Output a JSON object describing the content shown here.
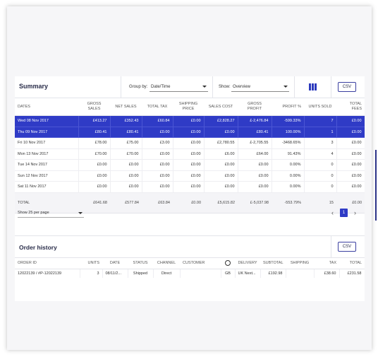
{
  "summary": {
    "title": "Summary",
    "group_by_label": "Group by:",
    "group_by_value": "Date/Time",
    "show_label": "Show:",
    "show_value": "Overview",
    "csv_label": "CSV",
    "headers": [
      "DATES",
      "GROSS SALES",
      "NET SALES",
      "TOTAL TAX",
      "SHIPPING PRICE",
      "SALES COST",
      "GROSS PROFIT",
      "PROFIT %",
      "UNITS SOLD",
      "TOTAL FEES"
    ],
    "rows": [
      {
        "selected": true,
        "cells": [
          "Wed 08 Nov 2017",
          "£413.27",
          "£352.43",
          "£60.84",
          "£0.00",
          "£2,828.27",
          "£-2,476.84",
          "-599.33%",
          "7",
          "£0.00"
        ]
      },
      {
        "selected": true,
        "cells": [
          "Thu 09 Nov 2017",
          "£80.41",
          "£80.41",
          "£0.00",
          "£0.00",
          "£0.00",
          "£80.41",
          "100.00%",
          "1",
          "£0.00"
        ]
      },
      {
        "selected": false,
        "cells": [
          "Fri 10 Nov 2017",
          "£78.00",
          "£75.00",
          "£3.00",
          "£0.00",
          "£2,780.55",
          "£-2,705.55",
          "-3468.65%",
          "3",
          "£0.00"
        ]
      },
      {
        "selected": false,
        "cells": [
          "Mon 13 Nov 2017",
          "£70.00",
          "£70.00",
          "£0.00",
          "£0.00",
          "£6.00",
          "£64.00",
          "91.43%",
          "4",
          "£0.00"
        ]
      },
      {
        "selected": false,
        "cells": [
          "Tue 14 Nov 2017",
          "£0.00",
          "£0.00",
          "£0.00",
          "£0.00",
          "£0.00",
          "£0.00",
          "0.00%",
          "0",
          "£0.00"
        ]
      },
      {
        "selected": false,
        "cells": [
          "Sun 12 Nov 2017",
          "£0.00",
          "£0.00",
          "£0.00",
          "£0.00",
          "£0.00",
          "£0.00",
          "0.00%",
          "0",
          "£0.00"
        ]
      },
      {
        "selected": false,
        "cells": [
          "Sat 11 Nov 2017",
          "£0.00",
          "£0.00",
          "£0.00",
          "£0.00",
          "£0.00",
          "£0.00",
          "0.00%",
          "0",
          "£0.00"
        ]
      }
    ],
    "total": [
      "TOTAL",
      "£641.68",
      "£577.84",
      "£63.84",
      "£0.00",
      "£5,615.82",
      "£-5,037.98",
      "-553.79%",
      "15",
      "£0.00"
    ]
  },
  "pager": {
    "per_page": "Show 25 per page",
    "current_page": "1",
    "prev": "‹",
    "next": "›"
  },
  "order_history": {
    "title": "Order history",
    "csv_label": "CSV",
    "headers": [
      "ORDER ID",
      "UNITS",
      "DATE",
      "STATUS",
      "CHANNEL",
      "CUSTOMER",
      "",
      "DELIVERY",
      "SUBTOTAL",
      "SHIPPING",
      "TAX",
      "TOTAL"
    ],
    "rows": [
      [
        "12022139 / #P-12022139",
        "3",
        "08/11/2...",
        "Shipped",
        "Direct",
        "",
        "GB",
        "UK Next...",
        "£192.98",
        "",
        "£38.60",
        "£231.58"
      ]
    ]
  },
  "icons": {
    "chart_toggle": "bar-chart-icon",
    "globe": "globe-icon"
  },
  "colors": {
    "accent": "#2f3bc6",
    "selected_row": "#2f3bc6"
  }
}
